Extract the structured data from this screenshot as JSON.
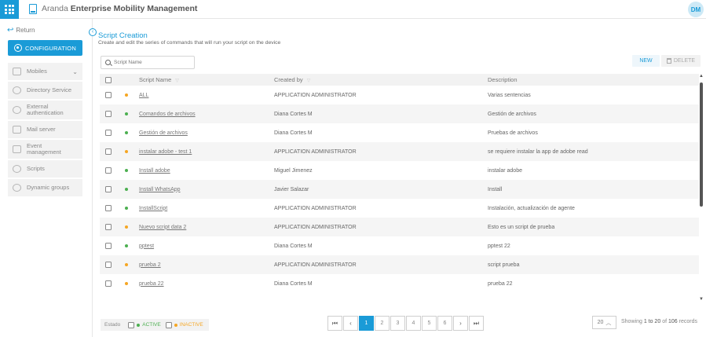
{
  "header": {
    "brand": "Aranda",
    "product": "Enterprise Mobility Management",
    "avatar": "DM"
  },
  "sidebar": {
    "return_label": "Return",
    "config_label": "CONFIGURATION",
    "items": [
      {
        "label": "Mobiles",
        "icon": "mobile-icon"
      },
      {
        "label": "Directory Service",
        "icon": "users-icon"
      },
      {
        "label": "External authentication",
        "icon": "shield-icon"
      },
      {
        "label": "Mail server",
        "icon": "mail-icon"
      },
      {
        "label": "Event management",
        "icon": "calendar-icon"
      },
      {
        "label": "Scripts",
        "icon": "gear-icon"
      },
      {
        "label": "Dynamic groups",
        "icon": "groups-icon"
      }
    ]
  },
  "main": {
    "title": "Script Creation",
    "subtitle": "Create and edit the series of commands that will run your script on the device",
    "search_placeholder": "Script Name",
    "new_label": "NEW",
    "delete_label": "DELETE"
  },
  "table": {
    "headers": {
      "name": "Script Name",
      "created_by": "Created by",
      "description": "Description"
    },
    "rows": [
      {
        "status": "inactive",
        "name": "ALL",
        "created_by": "APPLICATION ADMINISTRATOR",
        "description": "Varias sentencias"
      },
      {
        "status": "active",
        "name": "Comandos de archivos",
        "created_by": "Diana Cortes M",
        "description": "Gestión de archivos"
      },
      {
        "status": "active",
        "name": "Gestión de archivos",
        "created_by": "Diana Cortes M",
        "description": "Pruebas de archivos"
      },
      {
        "status": "inactive",
        "name": "instalar adobe - test 1",
        "created_by": "APPLICATION ADMINISTRATOR",
        "description": "se requiere instalar la app de adobe read"
      },
      {
        "status": "active",
        "name": "Install adobe",
        "created_by": "Miguel Jimenez",
        "description": "instalar adobe"
      },
      {
        "status": "active",
        "name": "Install WhatsApp",
        "created_by": "Javier Salazar",
        "description": "Install"
      },
      {
        "status": "active",
        "name": "InstallScript",
        "created_by": "APPLICATION ADMINISTRATOR",
        "description": "Instalación, actualización de agente"
      },
      {
        "status": "inactive",
        "name": "Nuevo script data 2",
        "created_by": "APPLICATION ADMINISTRATOR",
        "description": "Esto es un script de prueba"
      },
      {
        "status": "active",
        "name": "pptest",
        "created_by": "Diana Cortes M",
        "description": "pptest 22"
      },
      {
        "status": "inactive",
        "name": "prueba 2",
        "created_by": "APPLICATION ADMINISTRATOR",
        "description": "script prueba"
      },
      {
        "status": "inactive",
        "name": "prueba 22",
        "created_by": "Diana Cortes M",
        "description": "prueba 22"
      }
    ]
  },
  "footer": {
    "status_label": "Estado",
    "active_label": "ACTIVE",
    "inactive_label": "INACTIVE",
    "pages": [
      "1",
      "2",
      "3",
      "4",
      "5",
      "6"
    ],
    "current_page": "1",
    "per_page": "20",
    "records_prefix": "Showing",
    "records_range": "1 to 20",
    "records_of": "of",
    "records_total": "106",
    "records_suffix": "records"
  },
  "colors": {
    "accent": "#1a9bd7",
    "active": "#4caf50",
    "inactive": "#f5a623"
  }
}
